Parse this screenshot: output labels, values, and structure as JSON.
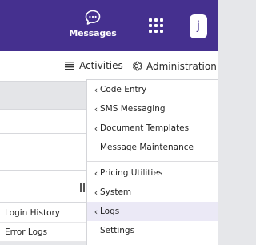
{
  "header": {
    "messages_label": "Messages",
    "avatar_initial": "j"
  },
  "nav": {
    "activities_label": "Activities",
    "administration_label": "Administration"
  },
  "left_submenu": {
    "items": [
      "Login History",
      "Error Logs"
    ]
  },
  "admin_menu": {
    "items": [
      {
        "label": "Code Entry",
        "chevron": "‹"
      },
      {
        "label": "SMS Messaging",
        "chevron": "‹"
      },
      {
        "label": "Document Templates",
        "chevron": "‹"
      },
      {
        "label": "Message Maintenance",
        "chevron": ""
      },
      {
        "label": "Pricing Utilities",
        "chevron": "‹"
      },
      {
        "label": "System",
        "chevron": "‹"
      },
      {
        "label": "Logs",
        "chevron": "‹",
        "active": true
      },
      {
        "label": "Settings",
        "chevron": ""
      }
    ]
  },
  "colors": {
    "topbar": "#45308f",
    "active_item_bg": "#ebe9f6"
  },
  "icons": {
    "messages": "chat-bubble-icon",
    "apps": "grid-icon",
    "activities": "list-icon",
    "administration": "gear-icon",
    "submenu": "chevron-left-icon"
  }
}
